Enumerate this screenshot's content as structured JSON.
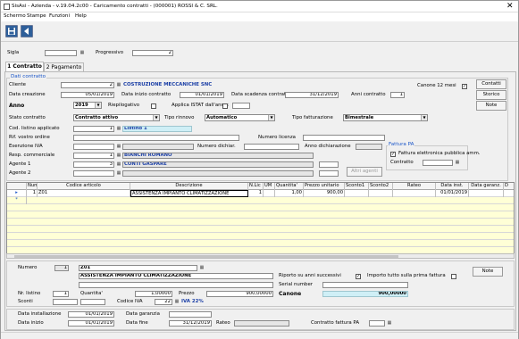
{
  "window": {
    "title": "SisAsi - Azienda - v.19.04.2c00 - Caricamento contratti - (000001) ROSSI & C. SRL.",
    "close": "✕"
  },
  "menu": {
    "items": [
      "Schermo",
      "Stampe",
      "Funzioni",
      "Help"
    ]
  },
  "toolbar": {
    "save_icon": "save-icon",
    "exit_icon": "exit-icon"
  },
  "header": {
    "sigla_label": "Sigla",
    "sigla_value": "",
    "progressivo_label": "Progressivo",
    "progressivo_value": "2"
  },
  "tabs": [
    {
      "label": "1 Contratto",
      "active": true
    },
    {
      "label": "2 Pagamento",
      "active": false
    }
  ],
  "dati": {
    "title": "Dati contratto",
    "cliente_label": "Cliente",
    "cliente_code": "2",
    "cliente_name": "COSTRUZIONE MECCANICHE SNC",
    "canone12_label": "Canone 12 mesi",
    "canone12_checked": "✓",
    "data_creazione_label": "Data creazione",
    "data_creazione": "05/01/2019",
    "data_inizio_label": "Data inizio contratto",
    "data_inizio": "01/01/2019",
    "data_scadenza_label": "Data scadenza contratto",
    "data_scadenza": "31/12/2019",
    "anni_label": "Anni contratto",
    "anni": "1",
    "anno_label": "Anno",
    "anno": "2019",
    "riepilogativo_label": "Riepilogativo",
    "istat_label": "Applica ISTAT dall'anno:",
    "stato_label": "Stato contratto",
    "stato": "Contratto attivo",
    "rinnovo_label": "Tipo rinnovo",
    "rinnovo": "Automatico",
    "fatturazione_label": "Tipo fatturazione",
    "fatturazione": "Bimestrale",
    "listino_label": "Cod. listino applicato",
    "listino_code": "1",
    "listino_name": "Listino 1",
    "ordine_label": "Rif. vostro ordine",
    "licenza_label": "Numero licenza",
    "esenzione_label": "Esenzione IVA",
    "dichiar_label": "Numero dichiar.",
    "anno_dichiar_label": "Anno dichiarazione",
    "resp_label": "Resp. commerciale",
    "resp_code": "1",
    "resp_name": "BIANCHI ROMANO",
    "agente1_label": "Agente 1",
    "agente1_code": "3",
    "agente1_name": "CONTI GASPARE",
    "agente2_label": "Agente 2",
    "altri_agenti": "Altri agenti",
    "fattura_pa_title": "Fattura PA",
    "fattura_pa_chk_label": "Fattura elettronica pubblica amm.",
    "fattura_pa_checked": "✓",
    "contratto_label": "Contratto",
    "btn_contatti": "Contatti",
    "btn_storico": "Storico",
    "btn_note": "Note"
  },
  "grid": {
    "columns": [
      "Num.",
      "Codice articolo",
      "Descrizione",
      "N.Lic",
      "UM",
      "Quantita'",
      "Prezzo unitario",
      "Sconto1",
      "Sconto2",
      "Rateo",
      "Data inst.",
      "Data garanz.",
      "D"
    ],
    "rows": [
      {
        "marker": "▸",
        "num": "1",
        "codice": "Z01",
        "descr": "ASSISTENZA IMPIANTO CLIMATIZZAZIONE",
        "nlic": "1",
        "um": "",
        "qta": "1,00",
        "prezzo": "900,00",
        "sc1": "",
        "sc2": "",
        "rateo": "",
        "data_inst": "01/01/2019",
        "data_garanz": ""
      }
    ],
    "new_marker": "*"
  },
  "detail": {
    "numero_label": "Numero",
    "numero": "1",
    "codice": "Z01",
    "descr": "ASSISTENZA IMPIANTO CLIMATIZZAZIONE",
    "riporto_label": "Riporto su anni successivi",
    "riporto_checked": "✓",
    "importo_label": "Importo tutto sulla prima fattura",
    "serial_label": "Serial number",
    "listino_label": "Nr. listino",
    "listino": "1",
    "qta_label": "Quantita'",
    "qta": "1,00000",
    "prezzo_label": "Prezzo",
    "prezzo": "900,00000",
    "canone_label": "Canone",
    "canone": "900,00000",
    "sconti_label": "Sconti",
    "iva_label": "Codice IVA",
    "iva_code": "22",
    "iva_name": "IVA 22%",
    "note_btn": "Note",
    "data_inst_label": "Data installazione",
    "data_inst": "01/01/2019",
    "data_garanzia_label": "Data garanzia",
    "data_inizio_label": "Data inizio",
    "data_inizio": "01/01/2019",
    "data_fine_label": "Data fine",
    "data_fine": "31/12/2019",
    "rateo_label": "Rateo",
    "contratto_pa_label": "Contratto fattura PA"
  }
}
